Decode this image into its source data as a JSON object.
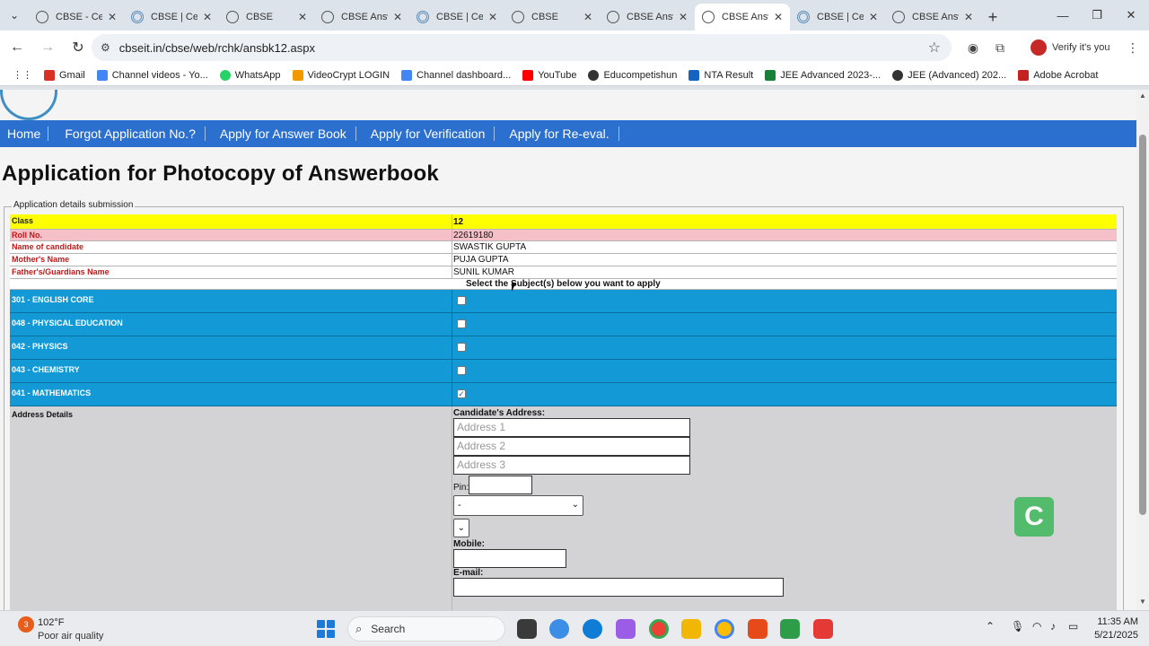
{
  "browser": {
    "tabs": [
      {
        "title": "CBSE - Cer",
        "active": false
      },
      {
        "title": "CBSE | Cer",
        "active": false
      },
      {
        "title": "CBSE",
        "active": false
      },
      {
        "title": "CBSE Answ",
        "active": false
      },
      {
        "title": "CBSE | Cer",
        "active": false
      },
      {
        "title": "CBSE",
        "active": false
      },
      {
        "title": "CBSE Answ",
        "active": false
      },
      {
        "title": "CBSE Answ",
        "active": true
      },
      {
        "title": "CBSE | Cer",
        "active": false
      },
      {
        "title": "CBSE Answ",
        "active": false
      }
    ],
    "url": "cbseit.in/cbse/web/rchk/ansbk12.aspx",
    "profile_label": "Verify it's you",
    "bookmarks": [
      {
        "label": "Gmail",
        "color": "#d93025"
      },
      {
        "label": "Channel videos - Yo...",
        "color": "#4285f4"
      },
      {
        "label": "WhatsApp",
        "color": "#25d366"
      },
      {
        "label": "VideoCrypt LOGIN",
        "color": "#f29900"
      },
      {
        "label": "Channel dashboard...",
        "color": "#4285f4"
      },
      {
        "label": "YouTube",
        "color": "#ff0000"
      },
      {
        "label": "Educompetishun",
        "color": "#333333"
      },
      {
        "label": "NTA Result",
        "color": "#1565c0"
      },
      {
        "label": "JEE Advanced 2023-...",
        "color": "#188038"
      },
      {
        "label": "JEE (Advanced) 202...",
        "color": "#333333"
      },
      {
        "label": "Adobe Acrobat",
        "color": "#c5221f"
      }
    ]
  },
  "site": {
    "menu": [
      "Home",
      "Forgot Application No.?",
      "Apply for Answer Book",
      "Apply for Verification",
      "Apply for Re-eval."
    ],
    "heading": "Application for Photocopy of Answerbook",
    "legend": "Application details submission",
    "details": {
      "class_label": "Class",
      "class_value": "12",
      "roll_label": "Roll No.",
      "roll_value": "22619180",
      "name_label": "Name of candidate",
      "name_value": "SWASTIK GUPTA",
      "mother_label": "Mother's Name",
      "mother_value": "PUJA GUPTA",
      "father_label": "Father's/Guardians Name",
      "father_value": "SUNIL KUMAR"
    },
    "select_caption": "Select the Subject(s) below you want to apply",
    "subjects": [
      {
        "label": "301 - ENGLISH CORE",
        "checked": false,
        "mark": ""
      },
      {
        "label": "048 - PHYSICAL EDUCATION",
        "checked": false,
        "mark": ""
      },
      {
        "label": "042 - PHYSICS",
        "checked": false,
        "mark": ""
      },
      {
        "label": "043 - CHEMISTRY",
        "checked": false,
        "mark": ""
      },
      {
        "label": "041 - MATHEMATICS",
        "checked": true,
        "mark": "✓"
      }
    ],
    "address": {
      "section_label": "Address Details",
      "title": "Candidate's Address:",
      "address1_placeholder": "Address 1",
      "address2_placeholder": "Address 2",
      "address3_placeholder": "Address 3",
      "pin_label": "Pin:",
      "state_value": "-",
      "mobile_label": "Mobile:",
      "email_label": "E-mail:"
    }
  },
  "taskbar": {
    "weather_badge": "3",
    "temperature": "102°F",
    "air_quality": "Poor air quality",
    "search_label": "Search",
    "time": "11:35 AM",
    "date": "5/21/2025"
  }
}
